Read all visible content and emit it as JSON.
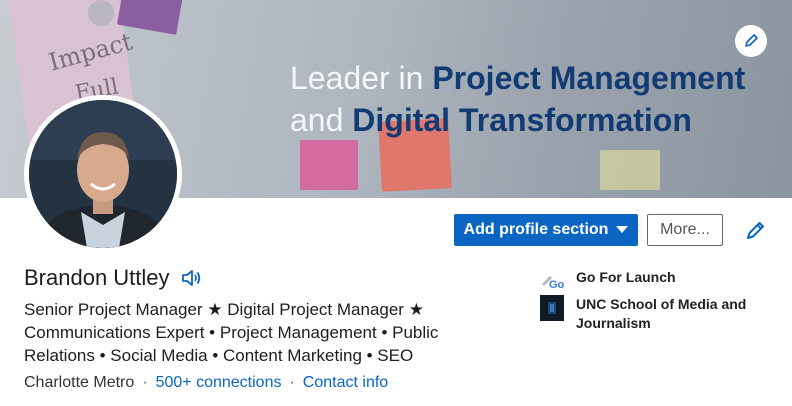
{
  "banner": {
    "line1_light": "Leader in ",
    "line1_dark": "Project Management",
    "line2_light": "and ",
    "line2_dark": "Digital Transformation",
    "note_text_1": "Impact",
    "note_text_2": "Full",
    "edit_icon": "pencil-icon"
  },
  "actions": {
    "add_section_label": "Add profile section",
    "add_section_icon": "caret-down-icon",
    "more_label": "More...",
    "edit_icon": "pencil-icon"
  },
  "profile": {
    "name": "Brandon Uttley",
    "name_icon": "speaker-icon",
    "headline": "Senior Project Manager ★ Digital Project Manager ★ Communications Expert • Project Management • Public Relations • Social Media • Content Marketing • SEO",
    "location": "Charlotte Metro",
    "connections": "500+ connections",
    "contact": "Contact info"
  },
  "experience": [
    {
      "name": "Go For Launch",
      "logo_text": "Go"
    },
    {
      "name": "UNC School of Media and Journalism",
      "logo_text": ""
    }
  ],
  "colors": {
    "accent": "#0a66c2",
    "banner_text": "#123b74"
  }
}
